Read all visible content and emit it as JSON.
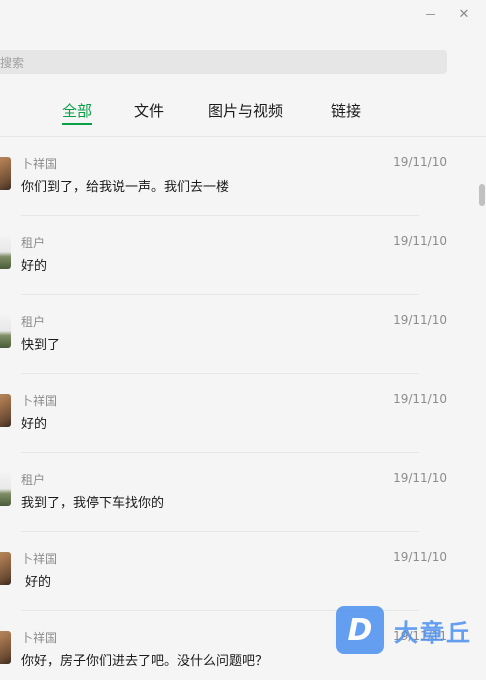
{
  "search": {
    "placeholder": "搜索"
  },
  "tabs": [
    {
      "label": "全部",
      "active": true
    },
    {
      "label": "文件",
      "active": false
    },
    {
      "label": "图片与视频",
      "active": false
    },
    {
      "label": "链接",
      "active": false
    }
  ],
  "messages": [
    {
      "sender": "卜祥国",
      "date": "19/11/10",
      "text": "你们到了，给我说一声。我们去一楼",
      "avatar": "person-photo-avatar"
    },
    {
      "sender": "租户",
      "date": "19/11/10",
      "text": "好的",
      "avatar": "landscape-photo-avatar"
    },
    {
      "sender": "租户",
      "date": "19/11/10",
      "text": "快到了",
      "avatar": "landscape-photo-avatar"
    },
    {
      "sender": "卜祥国",
      "date": "19/11/10",
      "text": "好的",
      "avatar": "person-photo-avatar"
    },
    {
      "sender": "租户",
      "date": "19/11/10",
      "text": "我到了，我停下车找你的",
      "avatar": "landscape-photo-avatar"
    },
    {
      "sender": "卜祥国",
      "date": "19/11/10",
      "text": "好的",
      "avatar": "person-photo-avatar"
    },
    {
      "sender": "卜祥国",
      "date": "19/11/11",
      "text": "你好，房子你们进去了吧。没什么问题吧？",
      "avatar": "person-photo-avatar"
    }
  ],
  "watermark": {
    "logo_letter": "D",
    "text": "大章丘",
    "color": "#4a8ff0"
  },
  "colors": {
    "accent": "#07a045",
    "background": "#f5f5f5"
  }
}
